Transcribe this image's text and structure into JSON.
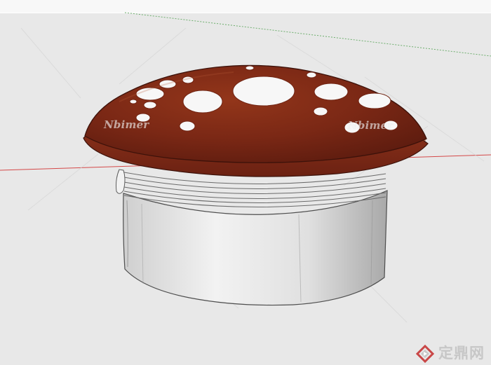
{
  "watermarks": {
    "left": "Nbimer",
    "right": "Nbimer"
  },
  "brand": {
    "text": "定鼎网",
    "logo_icon": "diamond-logo-icon"
  },
  "scene": {
    "cap_color": "#7a2a16",
    "cap_rim_color": "#8b3218",
    "body_color": "#d8d8d8",
    "red_axis_color": "#d84848",
    "green_axis_color": "#68a868"
  }
}
